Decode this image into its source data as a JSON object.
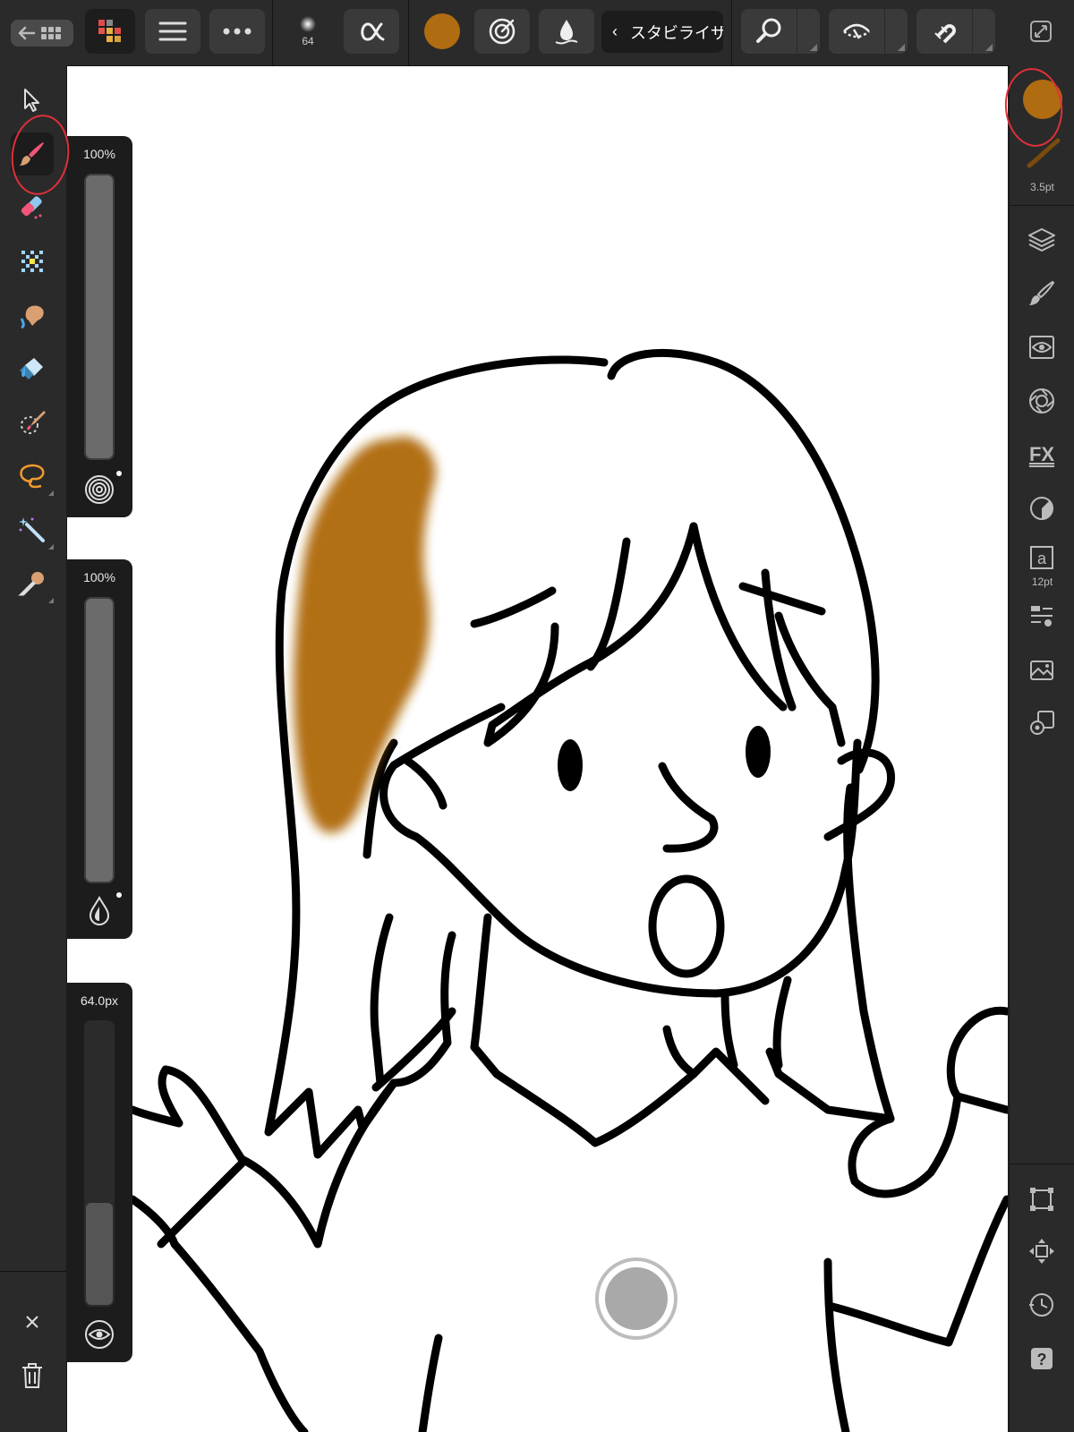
{
  "app": {
    "accent_color": "#b06c10",
    "toolbar": {
      "brush_size_badge": "64",
      "stabilizer_label": "スタビライザ",
      "buttons": [
        "back-to-gallery-icon",
        "studio-icon",
        "menu-icon",
        "more-icon",
        "brush-preview-icon",
        "opacity-alpha-icon",
        "color-swatch",
        "snapping-target-icon",
        "wet-edges-icon",
        "stabilizer-chevron-icon",
        "zoom-icon",
        "view-mode-icon",
        "magnet-icon",
        "fullscreen-icon"
      ]
    },
    "left_tools": [
      {
        "name": "move-tool",
        "icon": "pointer-icon",
        "active": false
      },
      {
        "name": "paint-brush-tool",
        "icon": "paint-brush-icon",
        "active": true
      },
      {
        "name": "erase-brush-tool",
        "icon": "eraser-icon",
        "active": false
      },
      {
        "name": "pixel-tool",
        "icon": "pixel-grid-icon",
        "active": false
      },
      {
        "name": "smudge-tool",
        "icon": "smudge-hand-icon",
        "active": false
      },
      {
        "name": "flood-fill-tool",
        "icon": "paint-bucket-icon",
        "active": false
      },
      {
        "name": "selection-brush-tool",
        "icon": "selection-brush-icon",
        "active": false
      },
      {
        "name": "freehand-selection-tool",
        "icon": "lasso-icon",
        "active": false
      },
      {
        "name": "magic-wand-tool",
        "icon": "magic-wand-icon",
        "active": false
      },
      {
        "name": "color-picker-tool",
        "icon": "eyedropper-icon",
        "active": false
      }
    ],
    "bottom_left": [
      "close-icon",
      "trash-icon"
    ],
    "sliders": [
      {
        "name": "opacity-slider",
        "value_label": "100%",
        "level": 1.0,
        "icon": "spiral-icon"
      },
      {
        "name": "flow-slider",
        "value_label": "100%",
        "level": 1.0,
        "icon": "droplet-icon"
      },
      {
        "name": "size-slider",
        "value_label": "64.0px",
        "level": 0.37,
        "icon": "eye-icon"
      }
    ],
    "right_panel": {
      "current_color": "#b06c10",
      "stroke_width_label": "3.5pt",
      "studios": [
        "layers-icon",
        "brushes-icon",
        "navigator-icon",
        "adjustments-icon",
        "fx-icon",
        "color-icon",
        "text-style-icon",
        "alignment-icon",
        "image-icon",
        "settings-gear-icon"
      ],
      "text_size_label": "12pt",
      "bottom_tools": [
        "transform-icon",
        "move-arrows-icon",
        "history-icon",
        "help-icon"
      ]
    },
    "canvas": {
      "paint_color": "#b06c10",
      "background": "#ffffff"
    }
  }
}
